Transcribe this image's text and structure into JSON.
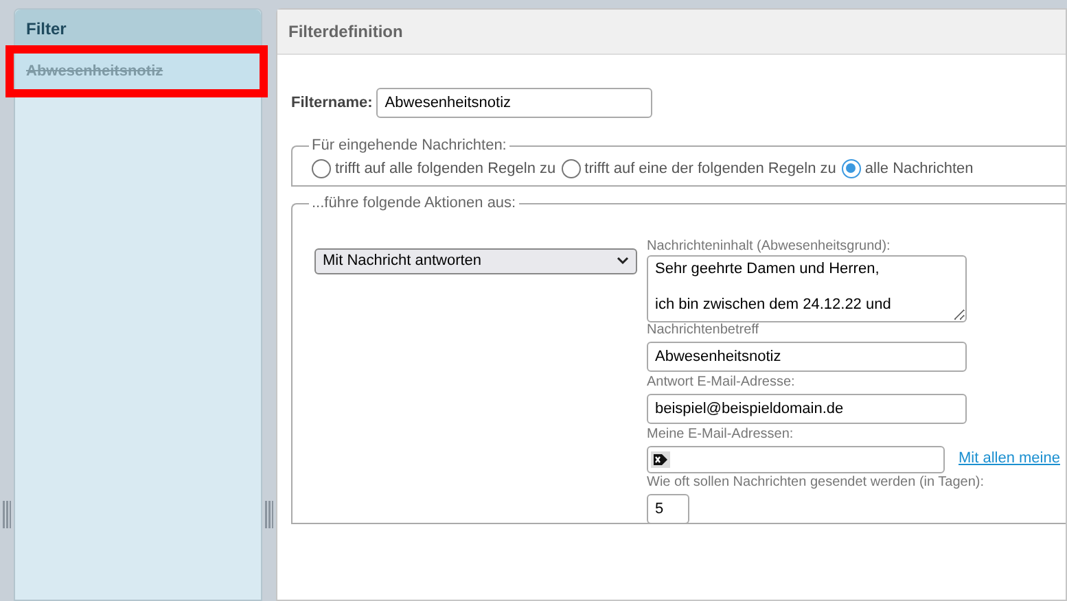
{
  "sidebar": {
    "title": "Filter",
    "items": [
      {
        "label": "Abwesenheitsnotiz",
        "disabled": true,
        "selected": true
      }
    ]
  },
  "panel": {
    "title": "Filterdefinition",
    "filtername": {
      "label": "Filtername:",
      "value": "Abwesenheitsnotiz"
    },
    "incoming": {
      "legend": "Für eingehende Nachrichten:",
      "options": [
        {
          "label": "trifft auf alle folgenden Regeln zu",
          "selected": false
        },
        {
          "label": "trifft auf eine der folgenden Regeln zu",
          "selected": false
        },
        {
          "label": "alle Nachrichten",
          "selected": true
        }
      ]
    },
    "actions": {
      "legend": "...führe folgende Aktionen aus:",
      "action": "Mit Nachricht antworten",
      "body": {
        "label": "Nachrichteninhalt (Abwesenheitsgrund):",
        "value": "Sehr geehrte Damen und Herren,\n\nich bin zwischen dem 24.12.22 und"
      },
      "subject": {
        "label": "Nachrichtenbetreff",
        "value": "Abwesenheitsnotiz"
      },
      "reply_address": {
        "label": "Antwort E-Mail-Adresse:",
        "value": "beispiel@beispieldomain.de"
      },
      "my_addresses": {
        "label": "Meine E-Mail-Adressen:",
        "link": "Mit allen meine"
      },
      "days": {
        "label": "Wie oft sollen Nachrichten gesendet werden (in Tagen):",
        "value": "5"
      }
    }
  }
}
